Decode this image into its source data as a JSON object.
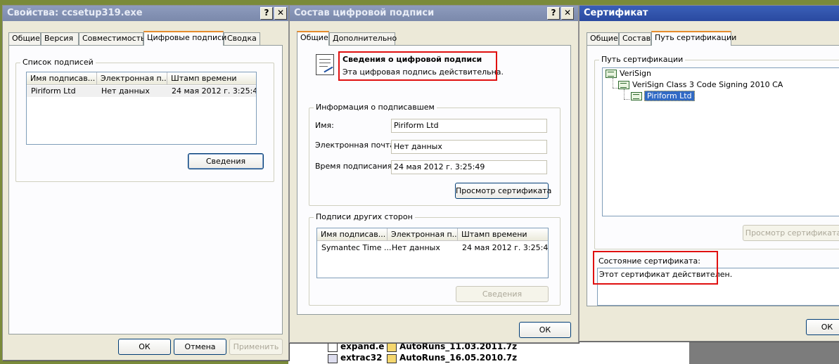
{
  "props_window": {
    "title": "Свойства: ccsetup319.exe",
    "help_btn": "?",
    "close_btn": "✕",
    "tabs": [
      "Общие",
      "Версия",
      "Совместимость",
      "Цифровые подписи",
      "Сводка"
    ],
    "group_label": "Список подписей",
    "columns": [
      "Имя подписав...",
      "Электронная п...",
      "Штамп времени"
    ],
    "rows": [
      [
        "Piriform Ltd",
        "Нет данных",
        "24 мая 2012 г. 3:25:49"
      ]
    ],
    "details_btn": "Сведения",
    "ok_btn": "ОК",
    "cancel_btn": "Отмена",
    "apply_btn": "Применить"
  },
  "sig_window": {
    "title": "Состав цифровой подписи",
    "help_btn": "?",
    "close_btn": "✕",
    "tabs": [
      "Общие",
      "Дополнительно"
    ],
    "info_title": "Сведения о цифровой подписи",
    "info_text": "Эта цифровая подпись действительна.",
    "signer_group": "Информация о подписавшем",
    "name_label": "Имя:",
    "name_value": "Piriform Ltd",
    "email_label": "Электронная почта:",
    "email_value": "Нет данных",
    "time_label": "Время подписания:",
    "time_value": "24 мая 2012 г. 3:25:49",
    "view_cert_btn": "Просмотр сертификата",
    "counter_group": "Подписи других сторон",
    "columns": [
      "Имя подписав...",
      "Электронная п...",
      "Штамп времени"
    ],
    "rows": [
      [
        "Symantec Time ...",
        "Нет данных",
        "24 мая 2012 г. 3:25:49"
      ]
    ],
    "details_btn": "Сведения",
    "ok_btn": "ОК"
  },
  "cert_window": {
    "title": "Сертификат",
    "tabs": [
      "Общие",
      "Состав",
      "Путь сертификации"
    ],
    "path_group": "Путь сертификации",
    "tree": [
      "VeriSign",
      "VeriSign Class 3 Code Signing 2010 CA",
      "Piriform Ltd"
    ],
    "view_cert_btn": "Просмотр сертификата",
    "status_label": "Состояние сертификата:",
    "status_text": "Этот сертификат действителен.",
    "ok_btn": "ОК"
  },
  "background_files": [
    {
      "left": "expand.e",
      "right": "AutoRuns_11.03.2011.7z"
    },
    {
      "left": "extrac32",
      "right": "AutoRuns_16.05.2010.7z"
    }
  ],
  "colors": {
    "highlight": "#e01010",
    "title_active": "#2a4aa0",
    "selection": "#316ac5"
  }
}
